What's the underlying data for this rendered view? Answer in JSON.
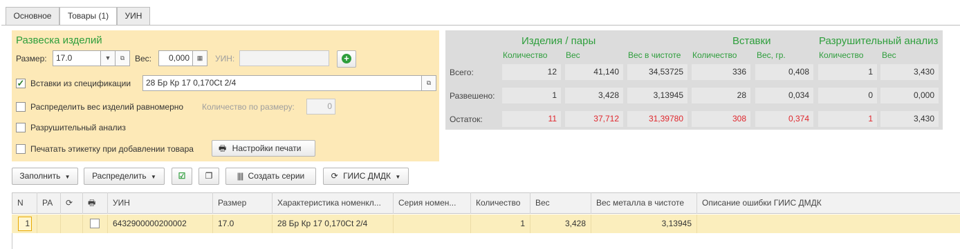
{
  "tabs": [
    "Основное",
    "Товары (1)",
    "УИН"
  ],
  "weigh": {
    "title": "Развеска изделий",
    "size_label": "Размер:",
    "size_value": "17.0",
    "weight_label": "Вес:",
    "weight_value": "0,000",
    "uin_label": "УИН:",
    "uin_value": "",
    "inserts_label": "Вставки из спецификации",
    "inserts_checked": true,
    "inserts_value": "28 Бр Кр 17 0,170Ct 2/4",
    "distribute_label": "Распределить вес изделий равномерно",
    "qty_by_size_label": "Количество по размеру:",
    "qty_by_size_value": "0",
    "destructive_label": "Разрушительный анализ",
    "print_label_label": "Печатать этикетку при добавлении товара",
    "print_settings_label": "Настройки печати"
  },
  "stats": {
    "group_items": "Изделия / пары",
    "group_inserts": "Вставки",
    "group_destructive": "Разрушительный анализ",
    "headers": [
      "Количество",
      "Вес",
      "Вес в чистоте",
      "Количество",
      "Вес, гр.",
      "Количество",
      "Вес"
    ],
    "rows": [
      {
        "label": "Всего:",
        "values": [
          "12",
          "41,140",
          "34,53725",
          "336",
          "0,408",
          "1",
          "3,430"
        ]
      },
      {
        "label": "Развешено:",
        "values": [
          "1",
          "3,428",
          "3,13945",
          "28",
          "0,034",
          "0",
          "0,000"
        ]
      },
      {
        "label": "Остаток:",
        "values": [
          "11",
          "37,712",
          "31,39780",
          "308",
          "0,374",
          "1",
          "3,430"
        ]
      }
    ],
    "red_color": "#e0262c"
  },
  "toolbar": {
    "fill": "Заполнить",
    "distribute": "Распределить",
    "create_series": "Создать серии",
    "giis": "ГИИС ДМДК"
  },
  "table": {
    "columns": [
      "N",
      "РА",
      "",
      "",
      "УИН",
      "Размер",
      "Характеристика номенкл...",
      "Серия номен...",
      "Количество",
      "Вес",
      "Вес металла в чистоте",
      "Описание ошибки ГИИС ДМДК"
    ],
    "rows": [
      {
        "n": "1",
        "ra": "",
        "uin": "6432900000200002",
        "size": "17.0",
        "char": "28 Бр Кр 17 0,170Ct 2/4",
        "series": "",
        "qty": "1",
        "weight": "3,428",
        "pure": "3,13945",
        "error": ""
      }
    ]
  },
  "colors": {
    "accent_green": "#2e9e3c",
    "panel_yellow": "#fde9b7",
    "row_yellow": "#fbeebd"
  }
}
